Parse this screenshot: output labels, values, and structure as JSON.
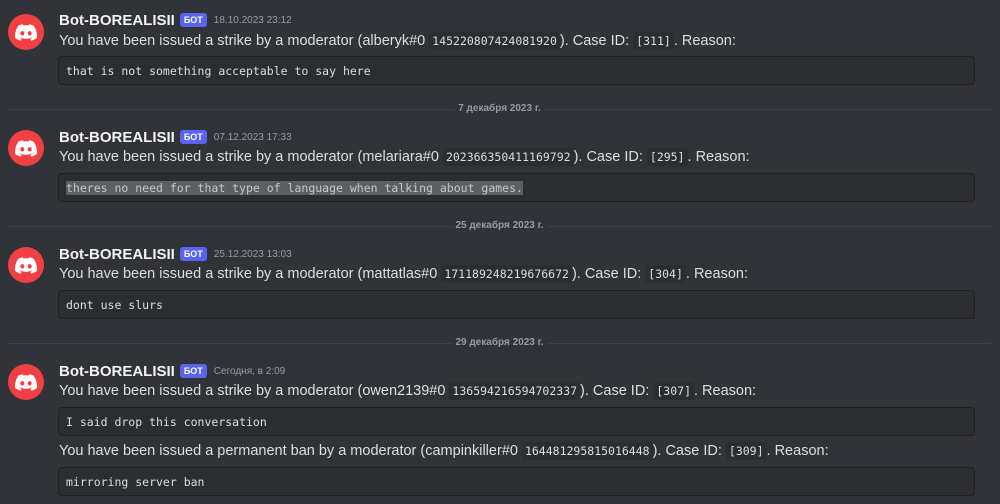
{
  "messages": [
    {
      "author": "Bot-BOREALISII",
      "bot_tag": "БОТ",
      "timestamp": "18.10.2023 23:12",
      "lines": [
        {
          "prefix": "You have been issued a strike by a moderator (alberyk#0 ",
          "user_id": "145220807424081920",
          "middle": "). Case ID: ",
          "case_id": "[311]",
          "suffix": ". Reason:",
          "reason": "that is not something acceptable to say here"
        }
      ]
    },
    {
      "author": "Bot-BOREALISII",
      "bot_tag": "БОТ",
      "timestamp": "07.12.2023 17:33",
      "lines": [
        {
          "prefix": "You have been issued a strike by a moderator (melariara#0 ",
          "user_id": "202366350411169792",
          "middle": "). Case ID: ",
          "case_id": "[295]",
          "suffix": ". Reason:",
          "reason": "theres no need for that type of language when talking about games."
        }
      ]
    },
    {
      "author": "Bot-BOREALISII",
      "bot_tag": "БОТ",
      "timestamp": "25.12.2023 13:03",
      "lines": [
        {
          "prefix": "You have been issued a strike by a moderator (mattatlas#0 ",
          "user_id": "171189248219676672",
          "middle": "). Case ID: ",
          "case_id": "[304]",
          "suffix": ". Reason:",
          "reason": "dont use slurs"
        }
      ]
    },
    {
      "author": "Bot-BOREALISII",
      "bot_tag": "БОТ",
      "timestamp": "Сегодня, в 2:09",
      "lines": [
        {
          "prefix": "You have been issued a strike by a moderator (owen2139#0 ",
          "user_id": "136594216594702337",
          "middle": "). Case ID: ",
          "case_id": "[307]",
          "suffix": ". Reason:",
          "reason": "I said drop this conversation"
        },
        {
          "prefix": "You have been issued a permanent ban by a moderator (campinkiller#0 ",
          "user_id": "164481295815016448",
          "middle": "). Case ID: ",
          "case_id": "[309]",
          "suffix": ". Reason:",
          "reason": "mirroring server ban"
        }
      ]
    }
  ],
  "dividers": [
    "7 декабря 2023 г.",
    "25 декабря 2023 г.",
    "29 декабря 2023 г."
  ],
  "colors": {
    "background": "#313338",
    "avatar": "#f23f43",
    "bot_tag": "#5865f2",
    "codeblock": "#2b2d31"
  },
  "icons": {
    "avatar": "discord-logo-icon"
  }
}
